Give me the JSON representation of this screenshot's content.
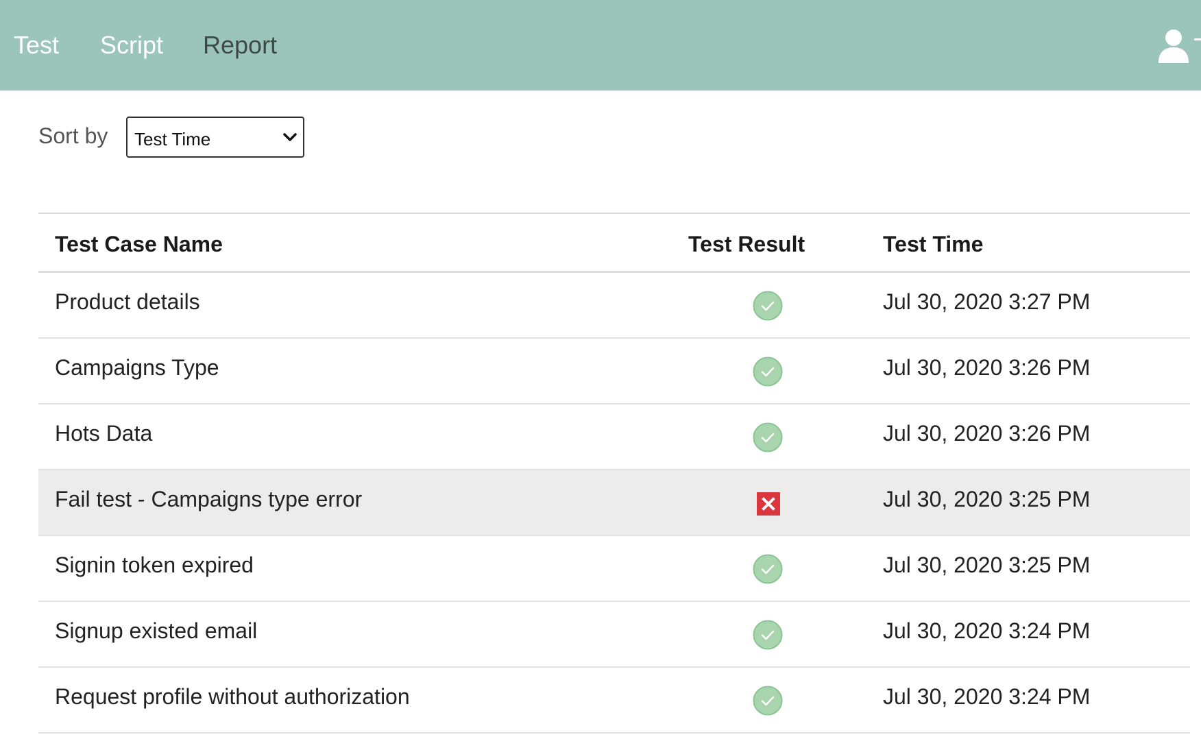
{
  "nav": {
    "items": [
      {
        "label": "Test",
        "icon": null
      },
      {
        "label": "Script",
        "icon": null
      },
      {
        "label": "Report",
        "icon": null
      }
    ],
    "user_icon": "user-icon",
    "colors": {
      "background": "#9bc5ba",
      "active_text": "#ffffff",
      "muted_text": "#3f4a47"
    }
  },
  "sort": {
    "label": "Sort by",
    "selected": "Test Time"
  },
  "table": {
    "columns": [
      "Test Case Name",
      "Test Result",
      "Test Time"
    ],
    "rows": [
      {
        "name": "Product details",
        "result": "pass",
        "time": "Jul 30, 2020 3:27 PM"
      },
      {
        "name": "Campaigns Type",
        "result": "pass",
        "time": "Jul 30, 2020 3:26 PM"
      },
      {
        "name": "Hots Data",
        "result": "pass",
        "time": "Jul 30, 2020 3:26 PM"
      },
      {
        "name": "Fail test - Campaigns type error",
        "result": "fail",
        "time": "Jul 30, 2020 3:25 PM"
      },
      {
        "name": "Signin token expired",
        "result": "pass",
        "time": "Jul 30, 2020 3:25 PM"
      },
      {
        "name": "Signup existed email",
        "result": "pass",
        "time": "Jul 30, 2020 3:24 PM"
      },
      {
        "name": "Request profile without authorization",
        "result": "pass",
        "time": "Jul 30, 2020 3:24 PM"
      }
    ],
    "colors": {
      "pass": "#a8d5ae",
      "fail": "#d9363e",
      "highlight_row": "#ececec"
    }
  }
}
